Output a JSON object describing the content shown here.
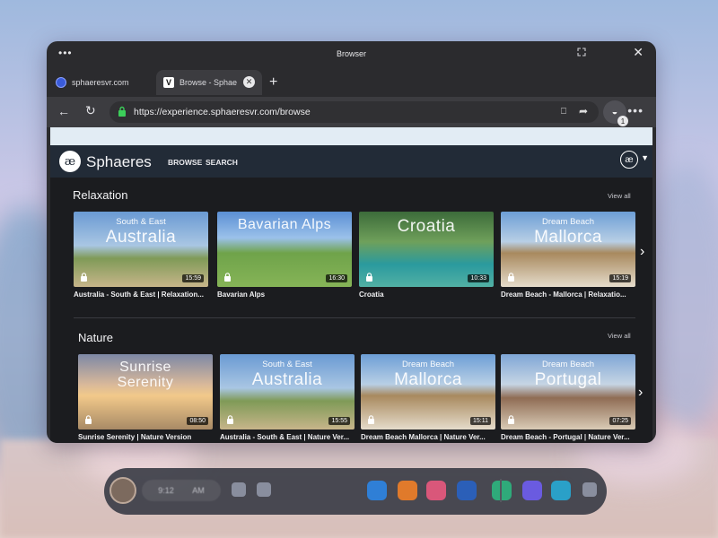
{
  "window": {
    "title": "Browser",
    "menu_glyph": "•••",
    "close_glyph": "✕"
  },
  "tabs": [
    {
      "label": "sphaeresvr.com",
      "active": false,
      "favicon": "sphaeres-favicon"
    },
    {
      "label": "Browse - Sphae",
      "active": true,
      "favicon": "v-favicon",
      "favicon_letter": "V"
    }
  ],
  "tab_new_glyph": "+",
  "address_bar": {
    "url": "https://experience.sphaeresvr.com/browse",
    "back_glyph": "←",
    "reload_glyph": "↻",
    "extensions_badge": "1",
    "more_glyph": "•••"
  },
  "site": {
    "logo_mark": "æ",
    "logo_text": "Sphaeres",
    "nav": [
      "BROWSE",
      "SEARCH"
    ],
    "avatar_glyph": "æ",
    "next_glyph": "›"
  },
  "sections": [
    {
      "title": "Relaxation",
      "view_all": "View all",
      "cards": [
        {
          "sub": "South & East",
          "main": "Australia",
          "duration": "15:59",
          "title": "Australia - South & East | Relaxation...",
          "bg": "linear-gradient(180deg,#6a9ad3 0%,#a9c6e3 45%,#7f9a57 62%,#c7b58a 100%)"
        },
        {
          "sub": "",
          "main": "Bavarian Alps",
          "duration": "16:30",
          "title": "Bavarian Alps",
          "bg": "linear-gradient(180deg,#5b8fd4 0%,#9bc1ea 35%,#6fa34a 55%,#86b457 100%)"
        },
        {
          "sub": "",
          "main": "Croatia",
          "duration": "10:33",
          "title": "Croatia",
          "bg": "linear-gradient(180deg,#3c6b3a 0%,#6fa05b 40%,#2a9a9e 70%,#52b0a4 100%)"
        },
        {
          "sub": "Dream Beach",
          "main": "Mallorca",
          "duration": "15:19",
          "title": "Dream Beach - Mallorca | Relaxatio...",
          "bg": "linear-gradient(180deg,#6d9ed6 0%,#b8cfe5 40%,#a8895e 55%,#e5dccb 100%)"
        }
      ]
    },
    {
      "title": "Nature",
      "view_all": "View all",
      "cards": [
        {
          "sub": "",
          "main": "Sunrise Serenity",
          "duration": "08:50",
          "title": "Sunrise Serenity | Nature Version",
          "bg": "linear-gradient(180deg,#7d88a6 0%,#d8b89a 40%,#f2c98a 55%,#a88a66 100%)"
        },
        {
          "sub": "South & East",
          "main": "Australia",
          "duration": "15:55",
          "title": "Australia - South & East | Nature Ver...",
          "bg": "linear-gradient(180deg,#6a9ad3 0%,#a9c6e3 45%,#7f9a57 62%,#c7b58a 100%)"
        },
        {
          "sub": "Dream Beach",
          "main": "Mallorca",
          "duration": "15:11",
          "title": "Dream Beach Mallorca | Nature Ver...",
          "bg": "linear-gradient(180deg,#6d9ed6 0%,#b8cfe5 40%,#a8895e 55%,#e5dccb 100%)"
        },
        {
          "sub": "Dream Beach",
          "main": "Portugal",
          "duration": "07:25",
          "title": "Dream Beach - Portugal | Nature Ver...",
          "bg": "linear-gradient(180deg,#7fa6d6 0%,#c6d5e4 40%,#8f6c54 58%,#d9cbb6 100%)"
        }
      ]
    }
  ],
  "taskbar": {
    "clock_left": "9:12",
    "clock_right": "AM",
    "apps": [
      {
        "name": "app-blue-icon",
        "color": "#2f7fd6"
      },
      {
        "name": "app-orange-icon",
        "color": "#e07a2b"
      },
      {
        "name": "app-pink-icon",
        "color": "#d9577a"
      },
      {
        "name": "app-browser-icon",
        "color": "#2b5fb8"
      },
      {
        "name": "app-green-icon",
        "color": "#2faa7a"
      },
      {
        "name": "app-purple-icon",
        "color": "#6a5be0"
      },
      {
        "name": "app-teal-icon",
        "color": "#2aa0c8"
      }
    ]
  }
}
